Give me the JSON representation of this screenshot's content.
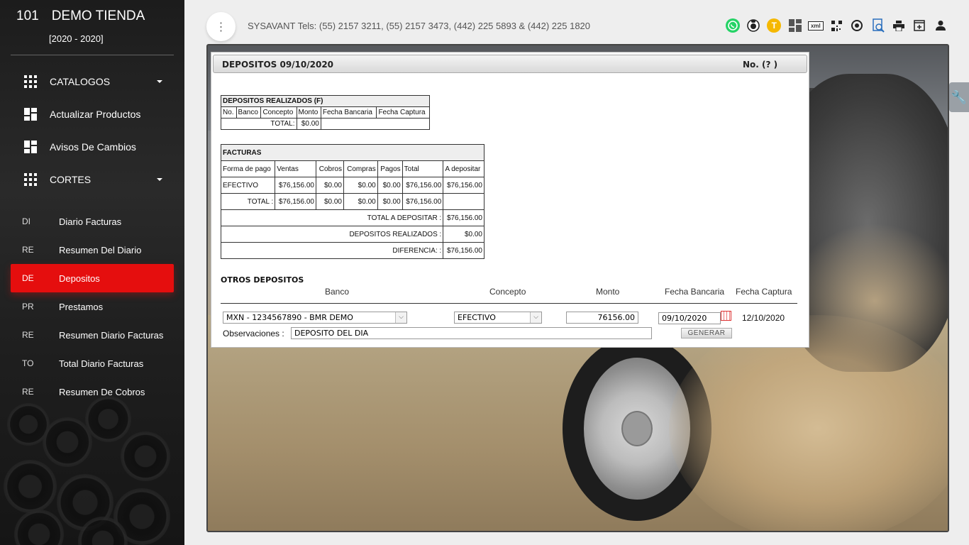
{
  "sidebar": {
    "store_code": "101",
    "store_name": "DEMO TIENDA",
    "period": "[2020 - 2020]",
    "nav": [
      {
        "label": "CATALOGOS",
        "icon": "grid-icon",
        "caret": true
      },
      {
        "label": "Actualizar Productos",
        "icon": "dashboard-icon"
      },
      {
        "label": "Avisos De Cambios",
        "icon": "dashboard-icon"
      },
      {
        "label": "CORTES",
        "icon": "grid-icon",
        "caret": true
      }
    ],
    "sub_items": [
      {
        "abbr": "DI",
        "label": "Diario Facturas"
      },
      {
        "abbr": "RE",
        "label": "Resumen Del Diario"
      },
      {
        "abbr": "DE",
        "label": "Depositos",
        "active": true
      },
      {
        "abbr": "PR",
        "label": "Prestamos"
      },
      {
        "abbr": "RE",
        "label": "Resumen Diario Facturas"
      },
      {
        "abbr": "TO",
        "label": "Total Diario Facturas"
      },
      {
        "abbr": "RE",
        "label": "Resumen De Cobros"
      }
    ]
  },
  "topbar": {
    "title": "SYSAVANT Tels: (55) 2157 3211, (55) 2157 3473, (442) 225 5893 & (442) 225 1820",
    "icons": [
      "whatsapp-icon",
      "support-icon",
      "t-badge-icon",
      "dashboard-icon",
      "xml-icon",
      "qr-code-icon",
      "target-icon",
      "search-document-icon",
      "print-icon",
      "new-window-icon",
      "user-icon"
    ],
    "t_badge": "T",
    "xml_label": "xml"
  },
  "panel": {
    "title": "DEPOSITOS 09/10/2020",
    "number": "No. (? )",
    "depositos_realizados": {
      "title": "DEPOSITOS REALIZADOS (F)",
      "headers": [
        "No.",
        "Banco",
        "Concepto",
        "Monto",
        "Fecha Bancaria",
        "Fecha Captura"
      ],
      "total_label": "TOTAL:",
      "total_value": "$0.00"
    },
    "facturas": {
      "title": "FACTURAS",
      "headers": [
        "Forma de pago",
        "Ventas",
        "Cobros",
        "Compras",
        "Pagos",
        "Total",
        "A depositar"
      ],
      "row": [
        "EFECTIVO",
        "$76,156.00",
        "$0.00",
        "$0.00",
        "$0.00",
        "$76,156.00",
        "$76,156.00"
      ],
      "total_row": [
        "TOTAL :",
        "$76,156.00",
        "$0.00",
        "$0.00",
        "$0.00",
        "$76,156.00"
      ],
      "total_a_depositar_label": "TOTAL A DEPOSITAR :",
      "total_a_depositar_value": "$76,156.00",
      "depositos_realizados_label": "DEPOSITOS REALIZADOS :",
      "depositos_realizados_value": "$0.00",
      "diferencia_label": "DIFERENCIA: :",
      "diferencia_value": "$76,156.00"
    },
    "otros": {
      "title": "OTROS DEPOSITOS",
      "col_banco": "Banco",
      "col_concepto": "Concepto",
      "col_monto": "Monto",
      "col_fecha_bancaria": "Fecha Bancaria",
      "col_fecha_captura": "Fecha Captura",
      "banco_value": "MXN - 1234567890 - BMR DEMO",
      "concepto_value": "EFECTIVO",
      "monto_value": "76156.00",
      "fecha_bancaria_value": "09/10/2020",
      "fecha_captura_value": "12/10/2020",
      "observaciones_label": "Observaciones :",
      "observaciones_value": "DEPOSITO DEL DIA",
      "generar_label": "GENERAR"
    }
  }
}
